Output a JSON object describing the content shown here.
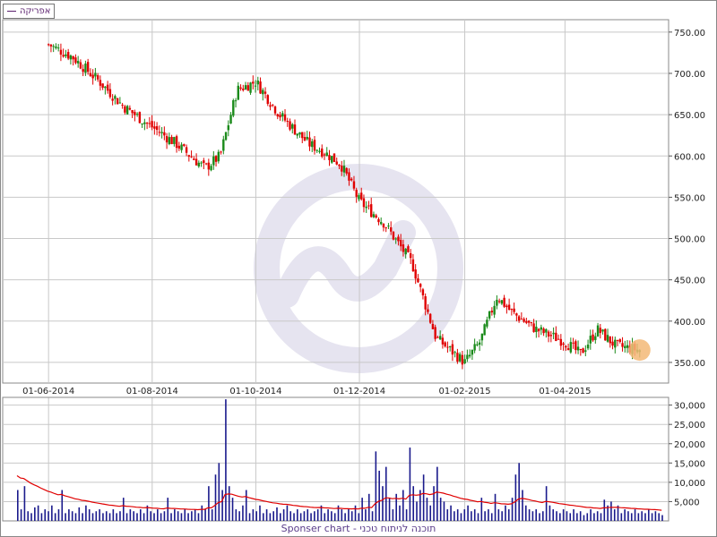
{
  "legend": {
    "label": "אפריקה"
  },
  "footer": {
    "text": "Sponser chart - תוכנה לניתוח טכני"
  },
  "colors": {
    "up": "#1a8a1a",
    "down": "#e00000",
    "volume": "#1a1a8c",
    "volume_ma": "#e00000",
    "grid": "#c8c8c8",
    "watermark": "#e6e4f0",
    "highlight": "#f3b877"
  },
  "chart_data": [
    {
      "type": "candlestick",
      "title": "",
      "xlabel": "",
      "ylabel": "",
      "ylim": [
        325,
        765
      ],
      "y_ticks": [
        "750.00",
        "700.00",
        "650.00",
        "600.00",
        "550.00",
        "500.00",
        "450.00",
        "400.00",
        "350.00"
      ],
      "x_ticks": [
        "01-06-2014",
        "01-08-2014",
        "01-10-2014",
        "01-12-2014",
        "01-02-2015",
        "01-04-2015"
      ],
      "grid": true,
      "series": [
        {
          "x": [
            "2014-06-01",
            "2014-06-15",
            "2014-07-01",
            "2014-07-15",
            "2014-08-01",
            "2014-08-15",
            "2014-09-01",
            "2014-09-10",
            "2014-09-20",
            "2014-10-01",
            "2014-10-15",
            "2014-11-01",
            "2014-11-10",
            "2014-11-20",
            "2014-12-01",
            "2014-12-15",
            "2015-01-01",
            "2015-01-15",
            "2015-02-01",
            "2015-02-10",
            "2015-02-20",
            "2015-03-01",
            "2015-03-15",
            "2015-04-01",
            "2015-04-10",
            "2015-04-20",
            "2015-05-01",
            "2015-05-15"
          ],
          "close": [
            735,
            720,
            690,
            660,
            635,
            615,
            585,
            600,
            680,
            690,
            650,
            615,
            605,
            590,
            545,
            520,
            470,
            380,
            350,
            375,
            430,
            410,
            390,
            375,
            360,
            390,
            370,
            365
          ]
        }
      ]
    },
    {
      "type": "bar",
      "title": "",
      "ylim": [
        0,
        32000
      ],
      "y_ticks": [
        "30,000",
        "25,000",
        "20,000",
        "15,000",
        "10,000",
        "5,000"
      ],
      "series": [
        {
          "values": [
            8000,
            3000,
            9000,
            2500,
            2000,
            3500,
            4000,
            2000,
            3000,
            2500,
            4000,
            2000,
            3000,
            8000,
            2000,
            3000,
            2500,
            2000,
            3500,
            2000,
            4000,
            3000,
            2000,
            2500,
            3000,
            2000,
            2500,
            2000,
            3000,
            2000,
            2500,
            6000,
            2000,
            3000,
            2500,
            2000,
            3000,
            2000,
            4000,
            2500,
            2000,
            3000,
            2000,
            2500,
            6000,
            2000,
            3000,
            2500,
            2000,
            3000,
            2000,
            2500,
            3000,
            2000,
            4000,
            3000,
            9000,
            3000,
            12000,
            15000,
            8000,
            31500,
            9000,
            6000,
            3000,
            2500,
            4000,
            8000,
            2000,
            3000,
            2500,
            4000,
            2000,
            3000,
            2000,
            2500,
            3500,
            2000,
            3000,
            4000,
            2500,
            2000,
            3000,
            2000,
            2500,
            3000,
            2000,
            2500,
            3000,
            4000,
            2000,
            3000,
            2500,
            2000,
            4000,
            3000,
            2000,
            3000,
            2500,
            4000,
            2000,
            6000,
            3000,
            7000,
            2500,
            18000,
            13000,
            9000,
            14000,
            6000,
            3000,
            7000,
            4000,
            8000,
            3000,
            19000,
            9000,
            5000,
            8000,
            12000,
            6000,
            4000,
            9000,
            14000,
            6000,
            5000,
            3000,
            4000,
            2500,
            3000,
            2000,
            3000,
            4000,
            2500,
            3000,
            2000,
            6000,
            2500,
            3000,
            2000,
            7000,
            3000,
            2500,
            4000,
            3000,
            6000,
            12000,
            15000,
            8000,
            4000,
            3000,
            2500,
            3000,
            2000,
            2500,
            9000,
            4000,
            3000,
            2500,
            2000,
            3000,
            2500,
            2000,
            3000,
            2000,
            2500,
            1500,
            2000,
            3000,
            2000,
            2500,
            2000,
            5500,
            4000,
            5000,
            3000,
            4000,
            2000,
            3000,
            2500,
            2000,
            3000,
            2000,
            2500,
            2000,
            3000,
            2000,
            2500,
            2000,
            1500
          ]
        },
        {
          "name": "",
          "ma": true
        }
      ]
    }
  ]
}
